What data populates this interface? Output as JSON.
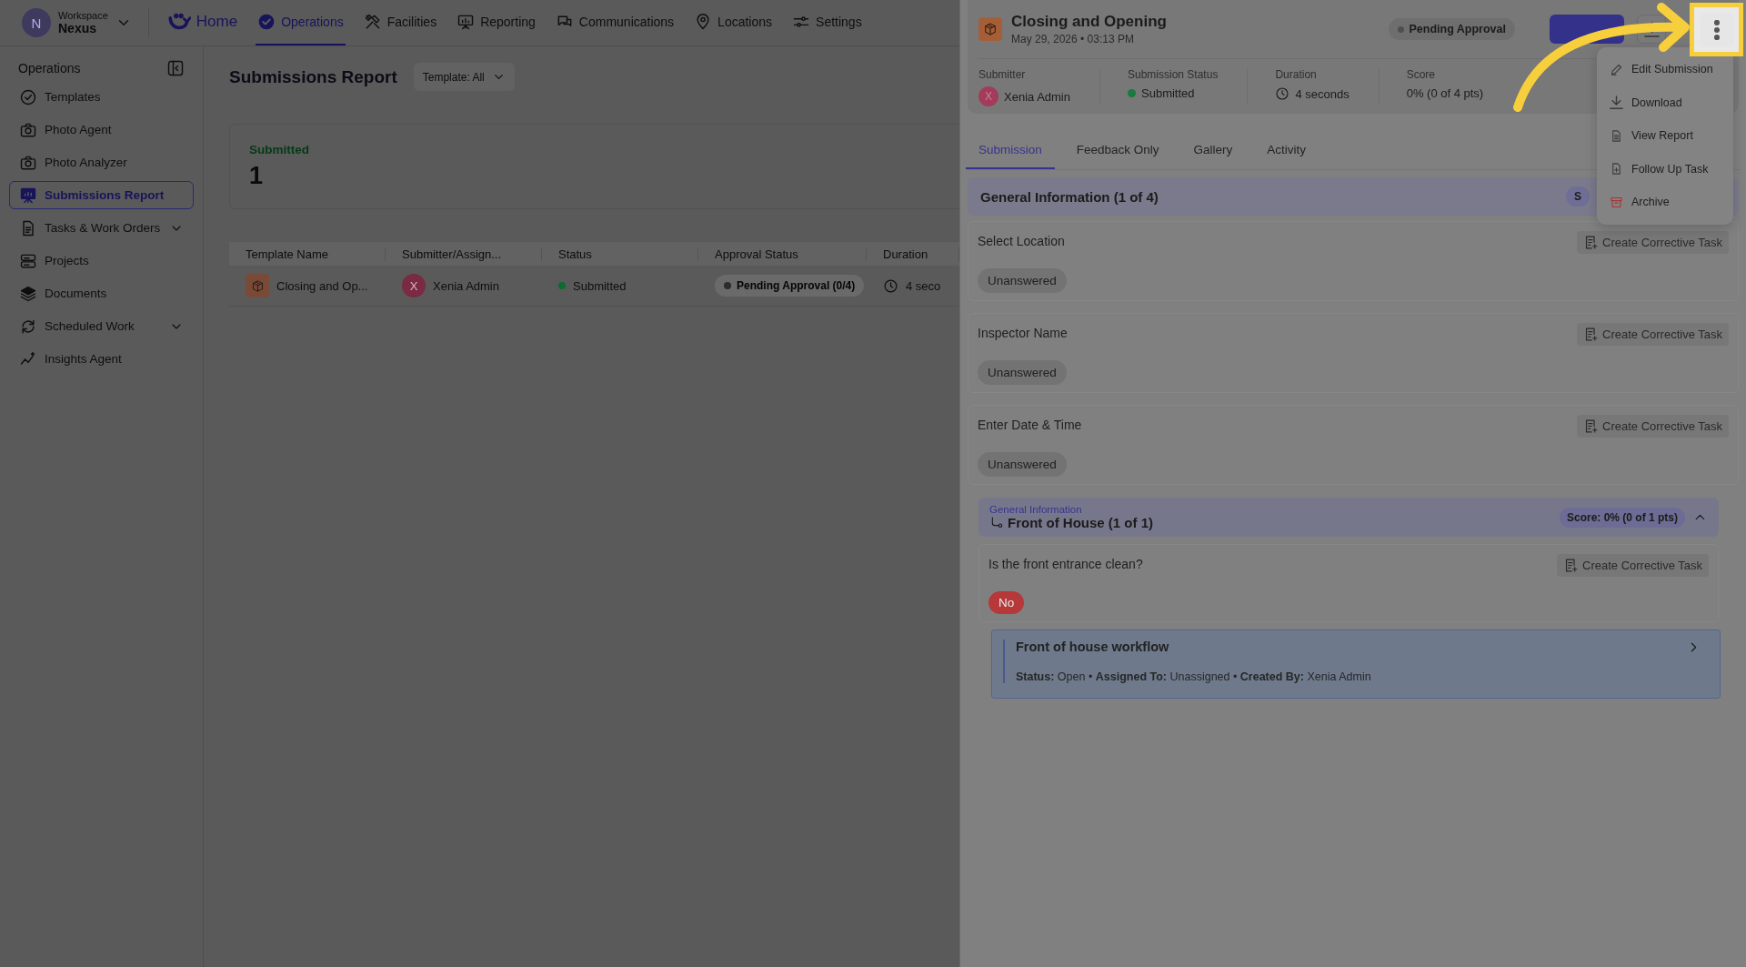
{
  "workspace": {
    "label": "Workspace",
    "name": "Nexus",
    "initial": "N"
  },
  "nav": [
    {
      "label": "Home",
      "kind": "brand",
      "selected": false
    },
    {
      "label": "Operations",
      "kind": "link",
      "selected": true
    },
    {
      "label": "Facilities",
      "kind": "link",
      "selected": false
    },
    {
      "label": "Reporting",
      "kind": "link",
      "selected": false
    },
    {
      "label": "Communications",
      "kind": "link",
      "selected": false
    },
    {
      "label": "Locations",
      "kind": "link",
      "selected": false
    },
    {
      "label": "Settings",
      "kind": "link",
      "selected": false
    }
  ],
  "sidebar": {
    "title": "Operations",
    "items": [
      {
        "label": "Templates",
        "selected": false,
        "expandable": false
      },
      {
        "label": "Photo Agent",
        "selected": false,
        "expandable": false
      },
      {
        "label": "Photo Analyzer",
        "selected": false,
        "expandable": false
      },
      {
        "label": "Submissions Report",
        "selected": true,
        "expandable": false
      },
      {
        "label": "Tasks & Work Orders",
        "selected": false,
        "expandable": true
      },
      {
        "label": "Projects",
        "selected": false,
        "expandable": false
      },
      {
        "label": "Documents",
        "selected": false,
        "expandable": false
      },
      {
        "label": "Scheduled Work",
        "selected": false,
        "expandable": true
      },
      {
        "label": "Insights Agent",
        "selected": false,
        "expandable": false
      }
    ]
  },
  "report": {
    "title": "Submissions Report",
    "filter": "Template: All",
    "stat": {
      "label": "Submitted",
      "value": "1"
    },
    "table": {
      "columns": [
        "Template Name",
        "Submitter/Assign...",
        "Status",
        "Approval Status",
        "Duration"
      ],
      "rows": [
        {
          "template": "Closing and Op...",
          "submitter_initial": "X",
          "submitter": "Xenia Admin",
          "status": "Submitted",
          "approval": "Pending Approval (0/4)",
          "duration": "4 seco"
        }
      ]
    }
  },
  "panel": {
    "title": "Closing and Opening",
    "date": "May 29, 2026 • 03:13 PM",
    "badge": "Pending Approval",
    "meta": [
      {
        "label": "Submitter",
        "value": "Xenia Admin",
        "kind": "avatar",
        "initial": "X"
      },
      {
        "label": "Submission Status",
        "value": "Submitted",
        "kind": "status"
      },
      {
        "label": "Duration",
        "value": "4 seconds",
        "kind": "duration"
      },
      {
        "label": "Score",
        "value": "0% (0 of 4 pts)",
        "kind": "text"
      }
    ],
    "tabs": [
      {
        "label": "Submission",
        "selected": true
      },
      {
        "label": "Feedback Only",
        "selected": false
      },
      {
        "label": "Gallery",
        "selected": false
      },
      {
        "label": "Activity",
        "selected": false
      }
    ],
    "section": {
      "title": "General Information (1 of 4)",
      "badge": "S"
    },
    "questions": [
      {
        "label": "Select Location",
        "answer": "Unanswered",
        "kind": "unanswered",
        "action": "Create Corrective Task"
      },
      {
        "label": "Inspector Name",
        "answer": "Unanswered",
        "kind": "unanswered",
        "action": "Create Corrective Task"
      },
      {
        "label": "Enter Date & Time",
        "answer": "Unanswered",
        "kind": "unanswered",
        "action": "Create Corrective Task"
      }
    ],
    "subsection": {
      "parent": "General Information",
      "title": "Front of House (1 of 1)",
      "score": "Score: 0% (0 of 1 pts)",
      "expanded": true,
      "questions": [
        {
          "label": "Is the front entrance clean?",
          "answer": "No",
          "kind": "negative",
          "action": "Create Corrective Task"
        }
      ],
      "task": {
        "title": "Front of house workflow",
        "details": "**Status:** Open • **Assigned To:**  Unassigned • **Created By:** Xenia Admin"
      }
    }
  },
  "menu": {
    "items": [
      {
        "label": "Edit Submission",
        "kind": "normal"
      },
      {
        "label": "Download",
        "kind": "normal"
      },
      {
        "label": "View Report",
        "kind": "normal"
      },
      {
        "label": "Follow Up Task",
        "kind": "normal"
      },
      {
        "label": "Archive",
        "kind": "danger"
      }
    ]
  }
}
